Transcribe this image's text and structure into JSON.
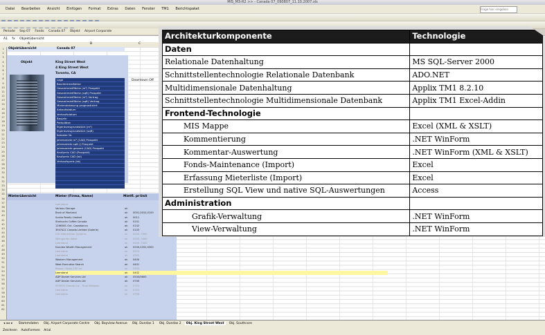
{
  "excel": {
    "window_title": "MIS_M3-R2 >> - Canada 07_090807_11.10.2007.xls",
    "menu": [
      "Datei",
      "Bearbeiten",
      "Ansicht",
      "Einfügen",
      "Format",
      "Extras",
      "Daten",
      "Fenster",
      "TM1",
      "Berichtspaket"
    ],
    "ask_question": "Frage hier eingeben",
    "params": [
      "Periode",
      "Sep 07",
      "Fonds",
      "Canada 07",
      "Objekt",
      "Airport Corporate"
    ],
    "namebox": "A1",
    "formula": "Objektübersicht",
    "col_headers": [
      "A",
      "B",
      "C"
    ],
    "object_label": "Objektübersicht",
    "object_value": "Canada 07",
    "object_caption": "Objekt",
    "address": [
      "King Street West",
      "4 King Street West",
      "Toronto, CA"
    ],
    "fields": [
      "Lage",
      "Baudenkmalfaktor",
      "Gesamtmietfläche (m²) Prospekt",
      "Gesamtmietfläche (sqft) Prospekt",
      "Gesamtmietfläche (m²) Vertrag",
      "Gesamtmietfläche (sqft) Vertrag",
      "Mietendekesung prognostiziert",
      "Ankaufsdatum",
      "Verkaufsdatum",
      "Baujahr",
      "Parkplätze",
      "Eigentumsgrundstück (m²)",
      "Eigentumsgrundstück (sqft)",
      "Kataster Nr.",
      "Jahresmiete m² (CAD) Prospekt",
      "Jahresmiete sqft () Prospekt",
      "Jahresmiete gesamt (CAD) Prospekt",
      "Kaufpreis CAD (Prospekt)",
      "Kaufpreis CAD (Ist)",
      "Verkaufspreis (Ist)"
    ],
    "lage_value": "Downtown Off",
    "tenant_header": {
      "section": "Mieterübersicht",
      "name": "Mieter (Firma, Name)",
      "col2": "Mietfl. pr",
      "col3": "Unit"
    },
    "tenants": [
      {
        "name": "Leerstand",
        "flag": "",
        "unit": "",
        "grey": true
      },
      {
        "name": "Various Storage",
        "flag": "ok",
        "unit": "",
        "grey": false
      },
      {
        "name": "Bank of Montreal",
        "flag": "ok",
        "unit": "0001,0010,0100",
        "grey": false
      },
      {
        "name": "Scotia Realty Limited",
        "flag": "ok",
        "unit": "0011",
        "grey": false
      },
      {
        "name": "Starbucks Coffee Canada",
        "flag": "ok",
        "unit": "0101",
        "grey": false
      },
      {
        "name": "1266381 Ont. Casablanca",
        "flag": "ok",
        "unit": "0102",
        "grey": false
      },
      {
        "name": "3947421 Canada Limited (Galerie)",
        "flag": "ok",
        "unit": "0103",
        "grey": false
      },
      {
        "name": "CGI Information Systems",
        "flag": "ok",
        "unit": "0200, 0300",
        "grey": true
      },
      {
        "name": "Weingarten Keller",
        "flag": "ok",
        "unit": "0200, 0300",
        "grey": true
      },
      {
        "name": "Leerstand",
        "flag": "ok",
        "unit": "0200, 0300",
        "grey": true
      },
      {
        "name": "Dundee Wealth Management",
        "flag": "ok",
        "unit": "0200,0202,0300",
        "grey": false
      },
      {
        "name": "Leerstand",
        "flag": "ok",
        "unit": "0222",
        "grey": true
      },
      {
        "name": "Leerstand",
        "flag": "ok",
        "unit": "0303",
        "grey": true
      },
      {
        "name": "Western Management",
        "flag": "ok",
        "unit": "0400",
        "grey": false
      },
      {
        "name": "West Executive Search",
        "flag": "ok",
        "unit": "0401",
        "grey": false
      },
      {
        "name": "Regus / Swiss 100 Inc",
        "flag": "ok",
        "unit": "0402",
        "grey": true
      },
      {
        "name": "Leerstand",
        "flag": "ok",
        "unit": "0402",
        "grey": false,
        "hl": true
      },
      {
        "name": "ADP Dealer Services Ltd",
        "flag": "ok",
        "unit": "0500/0600",
        "grey": false
      },
      {
        "name": "ADP Dealer Services Ltd",
        "flag": "ok",
        "unit": "0700",
        "grey": false
      },
      {
        "name": "959975 Ontario Inc - Trust Midtown",
        "flag": "ok",
        "unit": "0701",
        "grey": true
      },
      {
        "name": "Leerstand",
        "flag": "ok",
        "unit": "0701",
        "grey": true
      },
      {
        "name": "Leerstand",
        "flag": "ok",
        "unit": "0700",
        "grey": true
      }
    ],
    "sheet_tabs": [
      "Stammdaten",
      "Obj. Airport Corporate Centre",
      "Obj. Bayview Avenue",
      "Obj. Dundas 1",
      "Obj. Dundas 2",
      "Obj. King Street West",
      "Obj. Southcore"
    ],
    "active_tab": "Obj. King Street West",
    "drawbar": [
      "Zeichnen",
      "AutoFormen",
      "Arial"
    ]
  },
  "overlay": {
    "headers": [
      "Architekturkomponente",
      "Technologie"
    ],
    "rows": [
      {
        "kind": "section",
        "left": "Daten",
        "right": ""
      },
      {
        "kind": "row",
        "left": "Relationale Datenhaltung",
        "right": "MS SQL-Server 2000"
      },
      {
        "kind": "row",
        "left": "Schnittstellentechnologie Relationale Datenbank",
        "right": "ADO.NET"
      },
      {
        "kind": "row",
        "left": "Multidimensionale Datenhaltung",
        "right": "Applix TM1 8.2.10"
      },
      {
        "kind": "row",
        "left": "Schnittstellentechnologie Multidimensionale Datenbank",
        "right": "Applix TM1 Excel-Addin"
      },
      {
        "kind": "section",
        "left": "Frontend-Technologie",
        "right": ""
      },
      {
        "kind": "indent",
        "left": "MIS Mappe",
        "right": "Excel (XML & XSLT)"
      },
      {
        "kind": "indent",
        "left": "Kommentierung",
        "right": ".NET WinForm"
      },
      {
        "kind": "indent",
        "left": "Kommentar-Auswertung",
        "right": ".NET WinForm (XML & XSLT)"
      },
      {
        "kind": "indent",
        "left": "Fonds-Maintenance (Import)",
        "right": "Excel"
      },
      {
        "kind": "indent",
        "left": "Erfassung Mieterliste (Import)",
        "right": "Excel"
      },
      {
        "kind": "indent",
        "left": "Erstellung SQL View und native SQL-Auswertungen",
        "right": "Access"
      },
      {
        "kind": "section",
        "left": "Administration",
        "right": ""
      },
      {
        "kind": "indent2",
        "left": "Grafik-Verwaltung",
        "right": ".NET WinForm"
      },
      {
        "kind": "indent2",
        "left": "View-Verwaltung",
        "right": ".NET WinForm"
      }
    ]
  }
}
